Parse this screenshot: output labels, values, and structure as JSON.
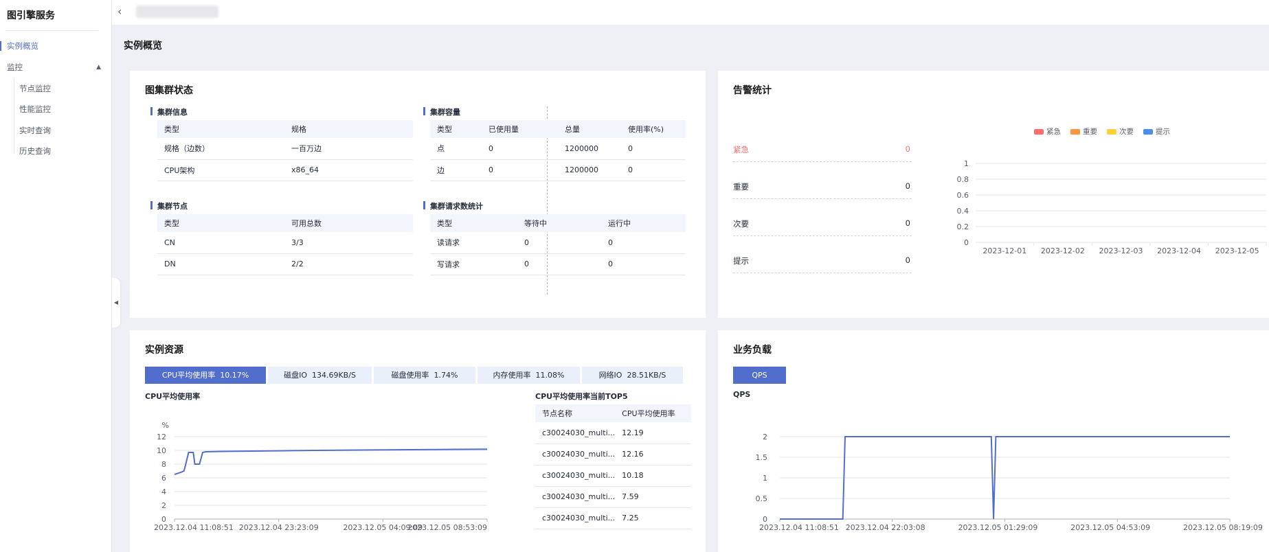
{
  "sidebar": {
    "title": "图引擎服务",
    "items": [
      {
        "label": "实例概览"
      },
      {
        "label": "监控"
      },
      {
        "label": "节点监控"
      },
      {
        "label": "性能监控"
      },
      {
        "label": "实时查询"
      },
      {
        "label": "历史查询"
      }
    ]
  },
  "page": {
    "title": "实例概览"
  },
  "cluster_status": {
    "title": "图集群状态",
    "info": {
      "title": "集群信息",
      "headers": [
        "类型",
        "规格"
      ],
      "rows": [
        [
          "规格（边数）",
          "一百万边"
        ],
        [
          "CPU架构",
          "x86_64"
        ]
      ]
    },
    "nodes": {
      "title": "集群节点",
      "headers": [
        "类型",
        "可用总数"
      ],
      "rows": [
        [
          "CN",
          "3/3"
        ],
        [
          "DN",
          "2/2"
        ]
      ]
    },
    "capacity": {
      "title": "集群容量",
      "headers": [
        "类型",
        "已使用量",
        "总量",
        "使用率(%)"
      ],
      "rows": [
        [
          "点",
          "0",
          "1200000",
          "0"
        ],
        [
          "边",
          "0",
          "1200000",
          "0"
        ]
      ]
    },
    "requests": {
      "title": "集群请求数统计",
      "headers": [
        "类型",
        "等待中",
        "运行中"
      ],
      "rows": [
        [
          "读请求",
          "0",
          "0"
        ],
        [
          "写请求",
          "0",
          "0"
        ]
      ]
    }
  },
  "alarm": {
    "title": "告警统计",
    "rows": [
      {
        "label": "紧急",
        "value": "0"
      },
      {
        "label": "重要",
        "value": "0"
      },
      {
        "label": "次要",
        "value": "0"
      },
      {
        "label": "提示",
        "value": "0"
      }
    ],
    "colors": [
      "#f66f6a",
      "#fa9841",
      "#ffd13b",
      "#4a90e2"
    ],
    "legend": [
      "紧急",
      "重要",
      "次要",
      "提示"
    ]
  },
  "resources": {
    "title": "实例资源",
    "tabs": [
      {
        "label": "CPU平均使用率",
        "value": "10.17%"
      },
      {
        "label": "磁盘IO",
        "value": "134.69KB/S"
      },
      {
        "label": "磁盘使用率",
        "value": "1.74%"
      },
      {
        "label": "内存使用率",
        "value": "11.08%"
      },
      {
        "label": "网络IO",
        "value": "28.51KB/S"
      }
    ],
    "chart_title": "CPU平均使用率",
    "top5": {
      "title": "CPU平均使用率当前TOP5",
      "headers": [
        "节点名称",
        "CPU平均使用率"
      ],
      "rows": [
        [
          "c30024030_multi...",
          "12.19"
        ],
        [
          "c30024030_multi...",
          "12.16"
        ],
        [
          "c30024030_multi...",
          "10.18"
        ],
        [
          "c30024030_multi...",
          "7.59"
        ],
        [
          "c30024030_multi...",
          "7.25"
        ]
      ]
    }
  },
  "workload": {
    "title": "业务负载",
    "button": "QPS",
    "chart_title": "QPS"
  },
  "chart_data": [
    {
      "type": "bar",
      "title": "",
      "categories": [
        "2023-12-01",
        "2023-12-02",
        "2023-12-03",
        "2023-12-04",
        "2023-12-05"
      ],
      "series": [
        {
          "name": "紧急",
          "values": [
            0,
            0,
            0,
            0,
            0
          ]
        },
        {
          "name": "重要",
          "values": [
            0,
            0,
            0,
            0,
            0
          ]
        },
        {
          "name": "次要",
          "values": [
            0,
            0,
            0,
            0,
            0
          ]
        },
        {
          "name": "提示",
          "values": [
            0,
            0,
            0,
            0,
            0
          ]
        }
      ],
      "yticks": [
        "0",
        "0.2",
        "0.4",
        "0.6",
        "0.8",
        "1"
      ],
      "ylim": [
        0,
        1
      ],
      "legend": "top-center"
    },
    {
      "type": "line",
      "title": "CPU平均使用率",
      "ylabel": "%",
      "ylim": [
        0,
        12
      ],
      "yticks": [
        "0",
        "2",
        "4",
        "6",
        "8",
        "10",
        "12"
      ],
      "xticks": [
        "2023.12.04 11:08:51",
        "2023.12.04 23:23:09",
        "2023.12.05 04:09:09",
        "2023.12.05 08:53:09"
      ],
      "series": [
        {
          "values": [
            6.5,
            6.8,
            7.0,
            7.8,
            9.7,
            9.7,
            9.7,
            8.0,
            8.0,
            8.0,
            9.7,
            9.8,
            9.85,
            9.9,
            9.95,
            10.0,
            10.05,
            10.1,
            10.15,
            10.17
          ]
        }
      ]
    },
    {
      "type": "line",
      "title": "QPS",
      "ylim": [
        0,
        2
      ],
      "yticks": [
        "0",
        "0.5",
        "1",
        "1.5",
        "2"
      ],
      "xticks": [
        "2023.12.04 11:08:51",
        "2023.12.04 22:03:08",
        "2023.12.05 01:29:09",
        "2023.12.05 04:53:09",
        "2023.12.05 08:19:09"
      ],
      "series": [
        {
          "points": [
            [
              0,
              0
            ],
            [
              0.14,
              0
            ],
            [
              0.145,
              2
            ],
            [
              0.47,
              2
            ],
            [
              0.475,
              0
            ],
            [
              0.48,
              2
            ],
            [
              1,
              2
            ]
          ]
        }
      ]
    }
  ]
}
